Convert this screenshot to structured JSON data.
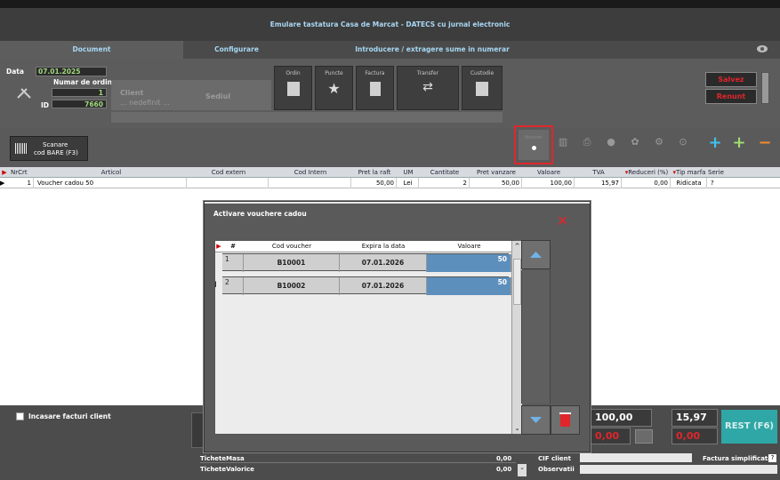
{
  "window": {
    "title": "Emulare tastatura Casa de Marcat  -  DATECS cu jurnal electronic"
  },
  "tabs": [
    "Document",
    "Configurare",
    "Introducere / extragere sume in numerar"
  ],
  "document": {
    "data_label": "Data",
    "data_value": "07.01.2025",
    "numar_label": "Numar de ordine",
    "numar_value": "1",
    "id_label": "ID",
    "id_value": "7660",
    "client_label": "Client",
    "client_value": "... nedefinit ...",
    "sediul_label": "Sediul"
  },
  "mode_buttons": [
    "Ordin",
    "Puncte",
    "Factura",
    "Transfer",
    "Custodie"
  ],
  "actions": {
    "salvez": "Salvez",
    "renunt": "Renunt"
  },
  "scan_button": {
    "line1": "Scanare",
    "line2": "cod BARE (F3)"
  },
  "toolbar_small": [
    "Voucher",
    "Cod",
    "Tiparire",
    "Detalii",
    "Retete",
    "Setari",
    "Cont"
  ],
  "grid": {
    "headers": [
      "NrCrt",
      "Articol",
      "Cod extern",
      "Cod Intern",
      "Pret la raft",
      "UM",
      "Cantitate",
      "Pret vanzare",
      "Valoare",
      "TVA",
      "Reduceri (%)",
      "Tip marfa",
      "Serie"
    ],
    "rows": [
      {
        "nr": "1",
        "articol": "Voucher cadou 50",
        "cod_extern": "",
        "cod_intern": "",
        "pret_raft": "50,00",
        "um": "Lei",
        "cantitate": "2",
        "pret_vanzare": "50,00",
        "valoare": "100,00",
        "tva": "15,97",
        "reduceri": "0,00",
        "tip_marfa": "Ridicata",
        "serie": "?"
      }
    ]
  },
  "modal": {
    "title": "Activare vouchere cadou",
    "headers": [
      "#",
      "Cod voucher",
      "Expira la data",
      "Valoare"
    ],
    "rows": [
      {
        "nr": "1",
        "cod": "B10001",
        "expira": "07.01.2026",
        "valoare": "50"
      },
      {
        "nr": "2",
        "cod": "B10002",
        "expira": "07.01.2026",
        "valoare": "50"
      }
    ]
  },
  "bottom": {
    "incasare": "Incasare facturi client",
    "total": "100,00",
    "total_tva": "15,97",
    "rest_a": "0,00",
    "rest_b": "0,00",
    "rest_button": "REST (F6)",
    "tichete_masa": "TicheteMasa",
    "tichete_masa_val": "0,00",
    "tichete_valorice": "TicheteValorice",
    "tichete_valorice_val": "0,00",
    "cif_label": "CIF client",
    "observatii_label": "Observatii",
    "factura_simplificata": "Factura simplificata",
    "help": "?"
  },
  "colors": {
    "accent_red": "#e0262b",
    "accent_teal": "#2fa7a6",
    "green": "#9fdc72"
  }
}
